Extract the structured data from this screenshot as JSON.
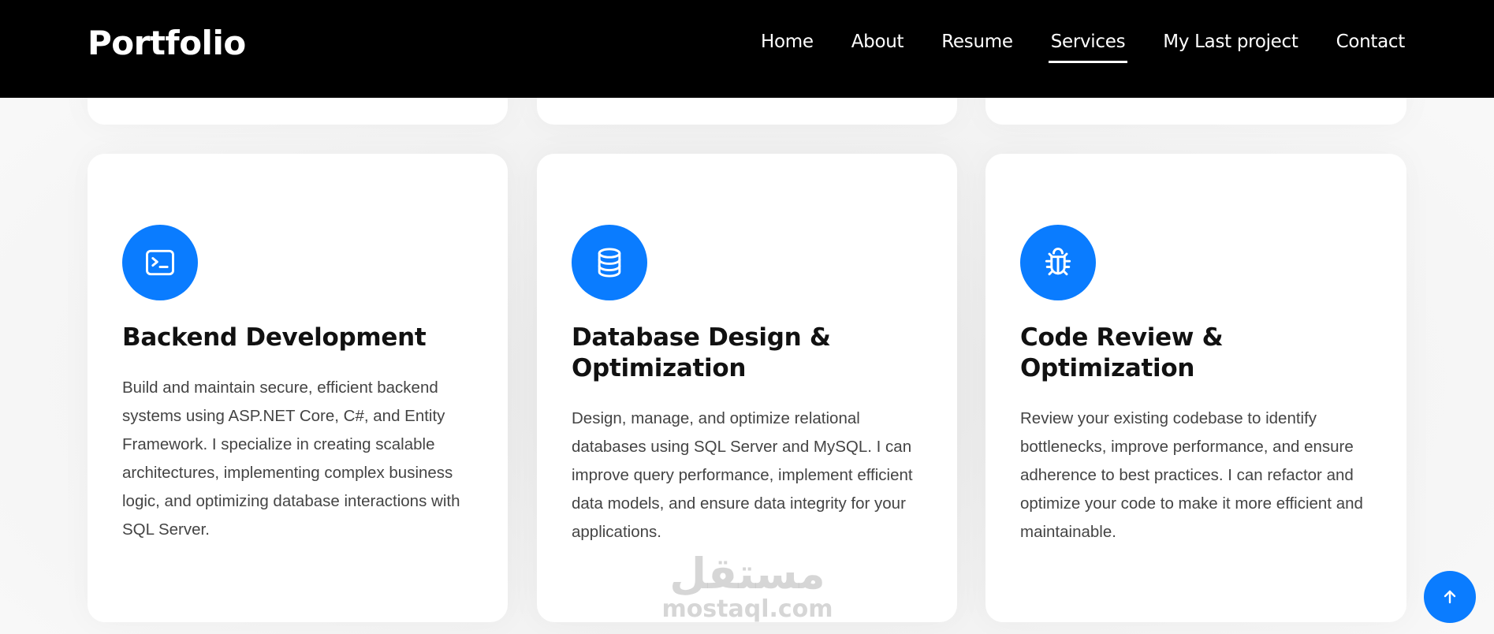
{
  "brand": {
    "logo": "Portfolio"
  },
  "nav": {
    "items": [
      {
        "label": "Home",
        "active": false
      },
      {
        "label": "About",
        "active": false
      },
      {
        "label": "Resume",
        "active": false
      },
      {
        "label": "Services",
        "active": true
      },
      {
        "label": "My Last project",
        "active": false
      },
      {
        "label": "Contact",
        "active": false
      }
    ]
  },
  "services": [
    {
      "icon": "terminal-icon",
      "title": "Backend Development",
      "description": "Build and maintain secure, efficient backend systems using ASP.NET Core, C#, and Entity Framework. I specialize in creating scalable architectures, implementing complex business logic, and optimizing database interactions with SQL Server."
    },
    {
      "icon": "database-icon",
      "title": "Database Design & Optimization",
      "description": "Design, manage, and optimize relational databases using SQL Server and MySQL. I can improve query performance, implement efficient data models, and ensure data integrity for your applications."
    },
    {
      "icon": "bug-icon",
      "title": "Code Review & Optimization",
      "description": "Review your existing codebase to identify bottlenecks, improve performance, and ensure adherence to best practices. I can refactor and optimize your code to make it more efficient and maintainable."
    }
  ],
  "watermark": {
    "arabic": "مستقل",
    "latin": "mostaql.com"
  },
  "colors": {
    "accent": "#0a7cff",
    "header_bg": "#000000"
  },
  "scroll_top": {
    "icon": "arrow-up-icon"
  }
}
